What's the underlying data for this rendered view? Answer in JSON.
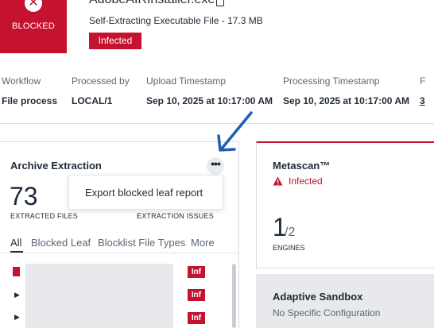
{
  "header": {
    "status_label": "BLOCKED",
    "status_icon": "x-icon",
    "file_name": "AdobeAIRInstaller.exe",
    "file_description": "Self-Extracting Executable File - 17.3 MB",
    "verdict_badge": "Infected"
  },
  "meta": {
    "workflow_label": "Workflow",
    "workflow_value": "File process",
    "processed_by_label": "Processed by",
    "processed_by_value": "LOCAL/1",
    "upload_label": "Upload Timestamp",
    "upload_value": "Sep 10, 2025 at 10:17:00 AM",
    "processing_label": "Processing Timestamp",
    "processing_value": "Sep 10, 2025 at 10:17:00 AM",
    "next_label": "F",
    "next_value": "3"
  },
  "archive": {
    "title": "Archive Extraction",
    "extracted_count": "73",
    "extracted_label": "EXTRACTED FILES",
    "issues_label": "EXTRACTION ISSUES",
    "menu_item": "Export blocked leaf report",
    "tabs": [
      "All",
      "Blocked Leaf",
      "Blocklist File Types",
      "More"
    ],
    "row_tags": [
      "Inf",
      "Inf",
      "Inf"
    ]
  },
  "metascan": {
    "title": "Metascan™",
    "status": "Infected",
    "engines_detected": "1",
    "engines_total": "/2",
    "engines_label": "ENGINES"
  },
  "sandbox": {
    "title": "Adaptive Sandbox",
    "subtitle": "No Specific Configuration"
  },
  "colors": {
    "accent_red": "#c4122f",
    "arrow_blue": "#1f5fb0"
  }
}
